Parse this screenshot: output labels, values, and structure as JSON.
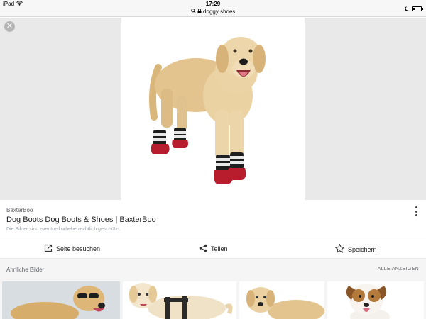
{
  "status_bar": {
    "device": "iPad",
    "time": "17:29",
    "url": "doggy shoes"
  },
  "result": {
    "source": "BaxterBoo",
    "title": "Dog Boots Dog Boots & Shoes | BaxterBoo",
    "copyright": "Die Bilder sind eventuell urheberrechtlich geschützt."
  },
  "actions": {
    "visit": "Seite besuchen",
    "share": "Teilen",
    "save": "Speichern"
  },
  "similar": {
    "title": "Ähnliche Bilder",
    "show_all": "ALLE ANZEIGEN"
  }
}
